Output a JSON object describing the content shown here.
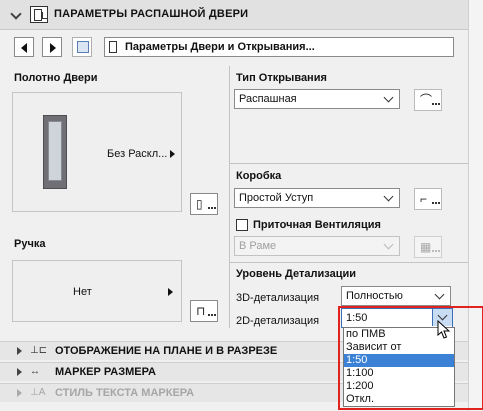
{
  "header": {
    "title": "ПАРАМЕТРЫ РАСПАШНОЙ ДВЕРИ"
  },
  "nav": {
    "selected": "Параметры Двери и Открывания..."
  },
  "panel_door": {
    "label": "Полотно Двери",
    "value": "Без Раскл..."
  },
  "panel_handle": {
    "label": "Ручка",
    "value": "Нет"
  },
  "opening": {
    "label": "Тип Открывания",
    "value": "Распашная"
  },
  "frame": {
    "label": "Коробка",
    "value": "Простой Уступ"
  },
  "ventilation": {
    "label": "Приточная Вентиляция",
    "value": "В Раме",
    "checked": false
  },
  "detail": {
    "label": "Уровень Детализации",
    "d3_label": "3D-детализация",
    "d3_value": "Полностью",
    "d2_label": "2D-детализация",
    "d2_value": "1:50"
  },
  "popup": {
    "options": [
      "по ПМВ",
      "Зависит от Масштаба",
      "1:50",
      "1:100",
      "1:200",
      "Откл."
    ],
    "selected_index": 2,
    "selected_color": "#3b82d6"
  },
  "sections": [
    {
      "label": "ОТОБРАЖЕНИЕ НА ПЛАНЕ И В РАЗРЕЗЕ",
      "icon": "plan-section-icon",
      "enabled": true
    },
    {
      "label": "МАРКЕР РАЗМЕРА",
      "icon": "dimension-marker-icon",
      "enabled": true
    },
    {
      "label": "СТИЛЬ ТЕКСТА МАРКЕРА",
      "icon": "text-style-icon",
      "enabled": false
    }
  ],
  "highlight_color": "#e0231f"
}
